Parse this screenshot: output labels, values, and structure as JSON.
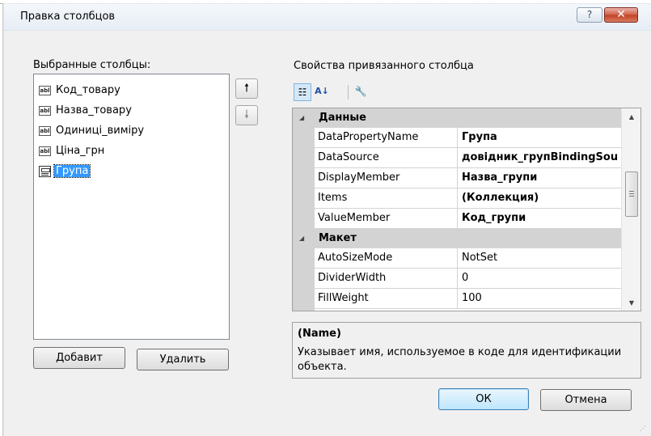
{
  "window": {
    "title": "Правка столбцов",
    "help_glyph": "?",
    "close_glyph": "✕"
  },
  "left_panel": {
    "label": "Выбранные столбцы:",
    "columns": [
      {
        "label": "Код_товару",
        "icon": "textbox-column-icon"
      },
      {
        "label": "Назва_товару",
        "icon": "textbox-column-icon"
      },
      {
        "label": "Одиниці_виміру",
        "icon": "textbox-column-icon"
      },
      {
        "label": "Ціна_грн",
        "icon": "textbox-column-icon"
      },
      {
        "label": "Група",
        "icon": "combobox-column-icon",
        "selected": true
      }
    ],
    "textbox_icon_glyph": "abl",
    "move_up_glyph": "🠕",
    "move_down_glyph": "🠗",
    "add_label": "Добавит",
    "remove_label": "Удалить"
  },
  "right_panel": {
    "label": "Свойства привязанного столбца",
    "toolbar": {
      "categorized_glyph": "☷",
      "alphabetical_glyph": "A↓",
      "property_pages_glyph": "🔧"
    },
    "categories": [
      {
        "name": "Данные",
        "properties": [
          {
            "name": "DataPropertyName",
            "value": "Група",
            "bold": true
          },
          {
            "name": "DataSource",
            "value": "довідник_групBindingSou",
            "bold": true
          },
          {
            "name": "DisplayMember",
            "value": "Назва_групи",
            "bold": true
          },
          {
            "name": "Items",
            "value": "(Коллекция)",
            "bold": true
          },
          {
            "name": "ValueMember",
            "value": "Код_групи",
            "bold": true
          }
        ]
      },
      {
        "name": "Макет",
        "properties": [
          {
            "name": "AutoSizeMode",
            "value": "NotSet",
            "bold": false
          },
          {
            "name": "DividerWidth",
            "value": "0",
            "bold": false
          },
          {
            "name": "FillWeight",
            "value": "100",
            "bold": false
          }
        ]
      }
    ],
    "expander_glyph": "◢",
    "description": {
      "title": "(Name)",
      "text": "Указывает имя, используемое в коде для идентификации объекта."
    }
  },
  "footer": {
    "ok_label": "ОК",
    "cancel_label": "Отмена"
  },
  "colors": {
    "selection": "#3399ff",
    "category_background": "#d3d3d3",
    "dialog_background": "#f0f0f0",
    "close_button": "#c24124"
  }
}
